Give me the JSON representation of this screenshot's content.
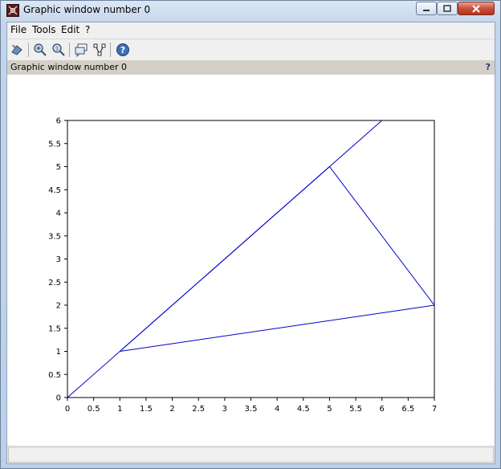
{
  "window": {
    "title": "Graphic window number 0",
    "icon": "scilab-graphic-icon"
  },
  "menu": {
    "items": [
      {
        "label": "File"
      },
      {
        "label": "Tools"
      },
      {
        "label": "Edit"
      },
      {
        "label": "?"
      }
    ]
  },
  "toolbar": {
    "buttons": [
      {
        "icon": "rotate-icon"
      },
      {
        "icon": "zoom-icon"
      },
      {
        "icon": "unzoom-icon"
      },
      {
        "icon": "datatip-icon"
      },
      {
        "icon": "graph-editor-icon"
      },
      {
        "icon": "help-icon"
      }
    ]
  },
  "infobar": {
    "text": "Graphic window number 0",
    "help": "?"
  },
  "colors": {
    "line": "#0000cc",
    "axes": "#000000"
  },
  "chart_data": {
    "type": "line",
    "xlim": [
      0,
      7
    ],
    "ylim": [
      0,
      6
    ],
    "x_ticks": [
      "0",
      "0.5",
      "1",
      "1.5",
      "2",
      "2.5",
      "3",
      "3.5",
      "4",
      "4.5",
      "5",
      "5.5",
      "6",
      "6.5",
      "7"
    ],
    "y_ticks": [
      "0",
      "0.5",
      "1",
      "1.5",
      "2",
      "2.5",
      "3",
      "3.5",
      "4",
      "4.5",
      "5",
      "5.5",
      "6"
    ],
    "grid": false,
    "series": [
      {
        "x": [
          0,
          6
        ],
        "y": [
          0,
          6
        ]
      },
      {
        "x": [
          1,
          5,
          7,
          1
        ],
        "y": [
          1,
          5,
          2,
          1
        ]
      }
    ]
  }
}
